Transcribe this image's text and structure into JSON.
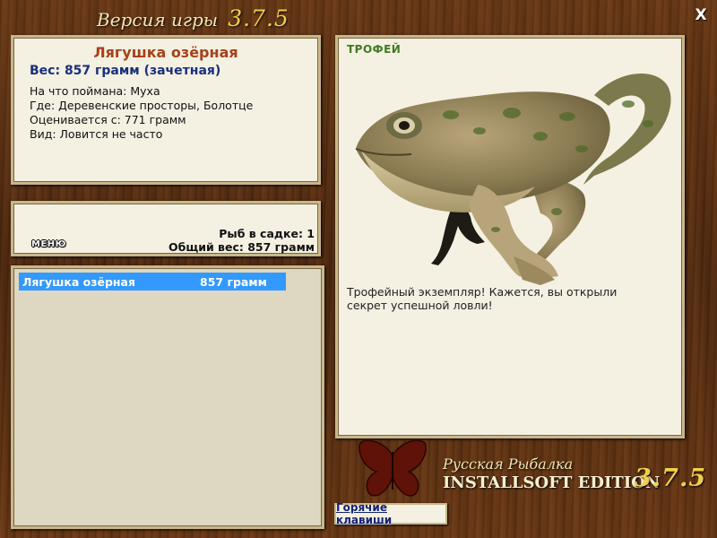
{
  "header": {
    "title_prefix": "Версия игры",
    "title_version": "3.7.5",
    "close_label": "X"
  },
  "fish_info": {
    "name": "Лягушка озёрная",
    "weight": "Вес: 857 грамм (зачетная)",
    "lines": [
      "На что поймана: Муха",
      "Где: Деревенские просторы, Болотце",
      "Оценивается с: 771 грамм",
      "Вид: Ловится не часто"
    ]
  },
  "cage": {
    "menu_label": "МЕНЮ",
    "count": "Рыб в садке: 1",
    "total_weight": "Общий вес: 857 грамм"
  },
  "fish_list": [
    {
      "name": "Лягушка озёрная",
      "weight": "857 грамм",
      "selected": true
    }
  ],
  "trophy": {
    "badge": "ТРОФЕЙ",
    "description": "Трофейный экземпляр! Кажется, вы открыли секрет успешной ловли!"
  },
  "logo": {
    "line1": "Русская Рыбалка",
    "line2": "INSTALLSOFT EDITION",
    "version": "3.7.5"
  },
  "hotkeys_label": "Горячие клавиши",
  "colors": {
    "wood": "#5a3214",
    "panel": "#f4f0e2",
    "selection": "#3399ff",
    "fish_name": "#a8401a",
    "weight_text": "#1a2f7a",
    "trophy_badge": "#3f7a20",
    "version_gold": "#f0cf4a"
  }
}
